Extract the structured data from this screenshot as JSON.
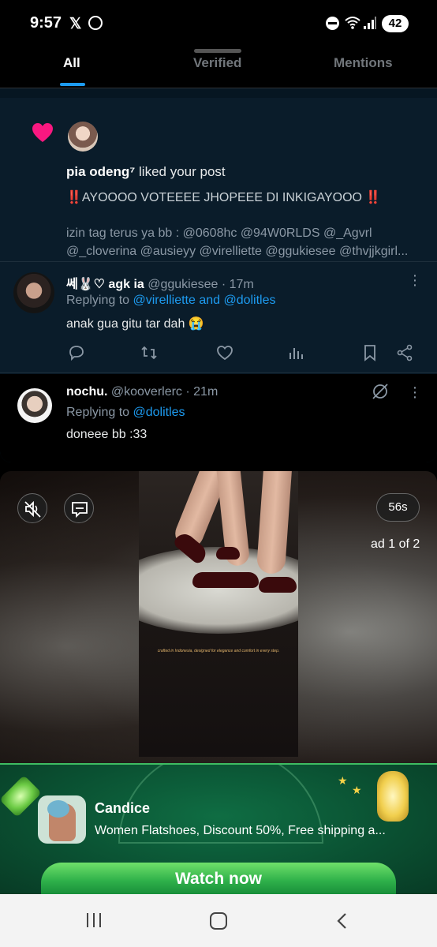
{
  "status_bar": {
    "time": "9:57",
    "x_glyph": "𝕏",
    "battery": "42"
  },
  "tabs": [
    {
      "label": "All",
      "active": true
    },
    {
      "label": "Verified",
      "active": false
    },
    {
      "label": "Mentions",
      "active": false
    }
  ],
  "like_notification": {
    "user": "pia odeng⁷",
    "action": " liked your post",
    "post_title": "‼️AYOOOO VOTEEEE JHOPEEE DI INKIGAYOOO ‼️",
    "post_snippet": "izin tag terus ya bb : @0608hc @94W0RLDS @_Agvrl @_cloverina @ausieyy @virelliette @ggukiesee @thvjjkgirl..."
  },
  "reply_1": {
    "display_name": "쎄🐰♡ agk ia",
    "handle_time": " @ggukiesee · 17m",
    "replying_prefix": "Replying to ",
    "replying_to": "@virelliette and @dolitles",
    "body": "anak gua gitu tar dah 😭"
  },
  "reply_2": {
    "display_name": "nochu.",
    "handle_time": " @kooverlerc · 21m",
    "replying_prefix": "Replying to ",
    "replying_to": "@dolitles",
    "body": "doneee bb :33"
  },
  "video_ad": {
    "time_left": "56s",
    "ad_counter": "ad 1 of 2",
    "caption": "crafted in Indonesia, designed for elegance and comfort in every step."
  },
  "ad_banner": {
    "app_name": "Candice",
    "description": "Women Flatshoes, Discount 50%, Free shipping a...",
    "cta": "Watch now"
  },
  "colors": {
    "accent": "#1d9bf0",
    "like": "#f91880",
    "banner_green": "#0f6d43"
  }
}
